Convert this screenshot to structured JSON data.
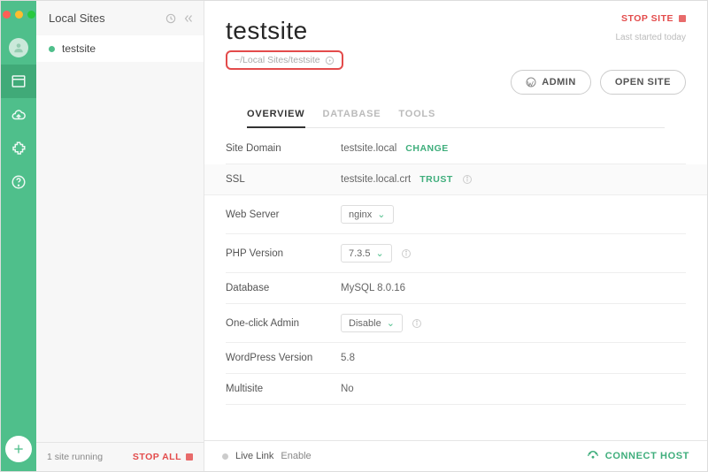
{
  "sidebar": {
    "title": "Local Sites",
    "items": [
      {
        "name": "testsite",
        "status": "running"
      }
    ],
    "footer": {
      "running_text": "1 site running",
      "stop_all": "STOP ALL"
    }
  },
  "header": {
    "site_name": "testsite",
    "stop_site": "STOP SITE",
    "last_started": "Last started today",
    "path": "~/Local Sites/testsite",
    "admin_btn": "ADMIN",
    "open_btn": "OPEN SITE"
  },
  "tabs": {
    "overview": "OVERVIEW",
    "database": "DATABASE",
    "tools": "TOOLS"
  },
  "overview": {
    "site_domain": {
      "label": "Site Domain",
      "value": "testsite.local",
      "action": "CHANGE"
    },
    "ssl": {
      "label": "SSL",
      "value": "testsite.local.crt",
      "action": "TRUST"
    },
    "web_server": {
      "label": "Web Server",
      "value": "nginx"
    },
    "php": {
      "label": "PHP Version",
      "value": "7.3.5"
    },
    "database": {
      "label": "Database",
      "value": "MySQL 8.0.16"
    },
    "one_click": {
      "label": "One-click Admin",
      "value": "Disable"
    },
    "wp": {
      "label": "WordPress Version",
      "value": "5.8"
    },
    "multisite": {
      "label": "Multisite",
      "value": "No"
    }
  },
  "footer": {
    "live_link": "Live Link",
    "enable": "Enable",
    "connect": "CONNECT HOST"
  }
}
